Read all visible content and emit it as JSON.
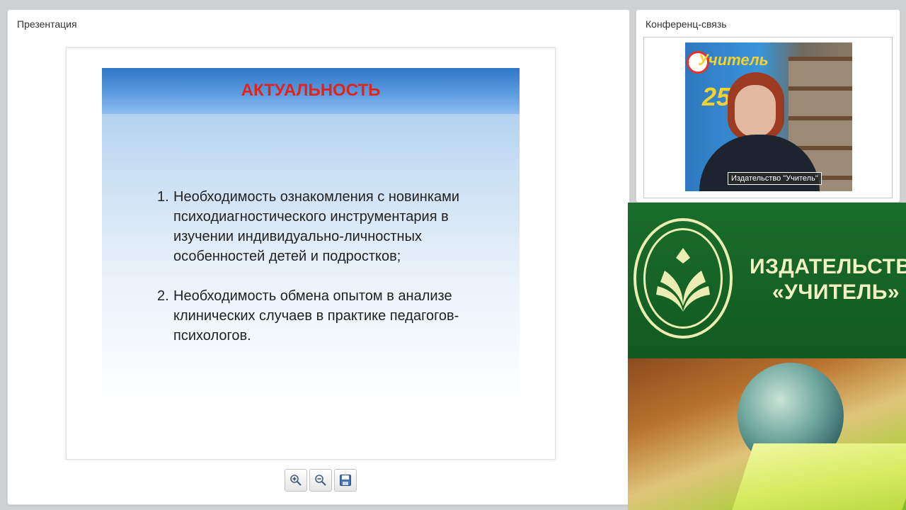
{
  "presentation": {
    "title": "Презентация",
    "slide": {
      "title": "АКТУАЛЬНОСТЬ",
      "items": [
        {
          "num": "1.",
          "text": "Необходимость ознакомления с  новинками психодиагностического инструментария в изучении  индивидуально-личностных особенностей детей и подростков;"
        },
        {
          "num": "2.",
          "text": "Необходимость обмена опытом в анализе клинических случаев в практике педагогов-психологов."
        }
      ]
    },
    "controls": [
      "zoom-in-icon",
      "zoom-out-icon",
      "save-icon"
    ]
  },
  "video": {
    "title": "Конференц-связь",
    "participant_name": "Издательство \"Учитель\"",
    "poster_text": "Учитель",
    "poster_number": "25"
  },
  "banner": {
    "line1": "ИЗДАТЕЛЬСТВО",
    "line2": "«УЧИТЕЛЬ»"
  },
  "colors": {
    "slide_title": "#e2231a",
    "banner_green": "#1a6d2b",
    "banner_text": "#f1f1c3"
  }
}
